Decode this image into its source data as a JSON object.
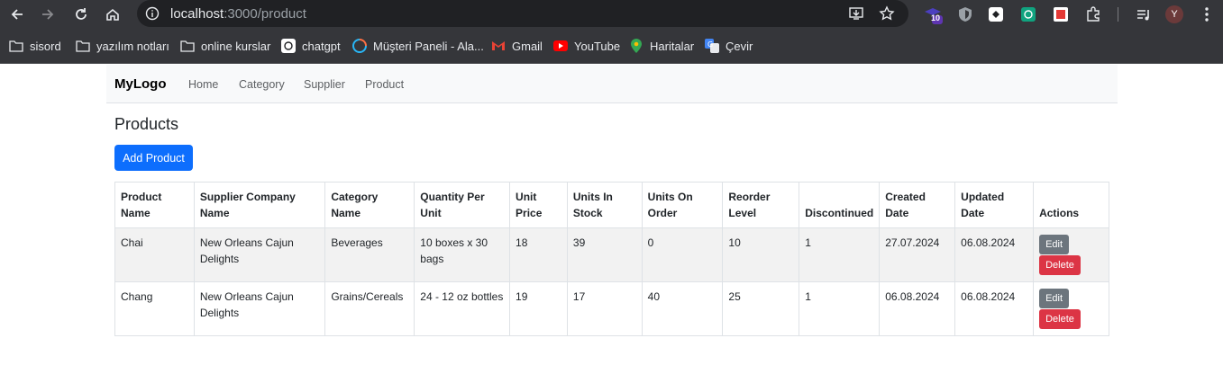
{
  "browser": {
    "url_host": "localhost",
    "url_path": ":3000/product",
    "extension_badge": "10",
    "profile_initial": "Y",
    "bookmarks": [
      {
        "label": "sisord",
        "icon": "folder-icon"
      },
      {
        "label": "yazılım notları",
        "icon": "folder-icon"
      },
      {
        "label": "online kurslar",
        "icon": "folder-icon"
      },
      {
        "label": "chatgpt",
        "icon": "chatgpt-icon"
      },
      {
        "label": "Müşteri Paneli - Ala...",
        "icon": "panel-icon"
      },
      {
        "label": "Gmail",
        "icon": "gmail-icon"
      },
      {
        "label": "YouTube",
        "icon": "youtube-icon"
      },
      {
        "label": "Haritalar",
        "icon": "maps-icon"
      },
      {
        "label": "Çevir",
        "icon": "translate-icon"
      }
    ]
  },
  "navbar": {
    "brand": "MyLogo",
    "links": [
      "Home",
      "Category",
      "Supplier",
      "Product"
    ]
  },
  "page": {
    "title": "Products",
    "add_button": "Add Product"
  },
  "table": {
    "headers": [
      "Product Name",
      "Supplier Company Name",
      "Category Name",
      "Quantity Per Unit",
      "Unit Price",
      "Units In Stock",
      "Units On Order",
      "Reorder Level",
      "Discontinued",
      "Created Date",
      "Updated Date",
      "Actions"
    ],
    "rows": [
      [
        "Chai",
        "New Orleans Cajun Delights",
        "Beverages",
        "10 boxes x 30 bags",
        "18",
        "39",
        "0",
        "10",
        "1",
        "27.07.2024",
        "06.08.2024"
      ],
      [
        "Chang",
        "New Orleans Cajun Delights",
        "Grains/Cereals",
        "24 - 12 oz bottles",
        "19",
        "17",
        "40",
        "25",
        "1",
        "06.08.2024",
        "06.08.2024"
      ]
    ],
    "edit_label": "Edit",
    "delete_label": "Delete"
  },
  "colors": {
    "primary": "#0d6efd",
    "secondary": "#6c757d",
    "danger": "#dc3545",
    "chrome_bg": "#35363a"
  }
}
